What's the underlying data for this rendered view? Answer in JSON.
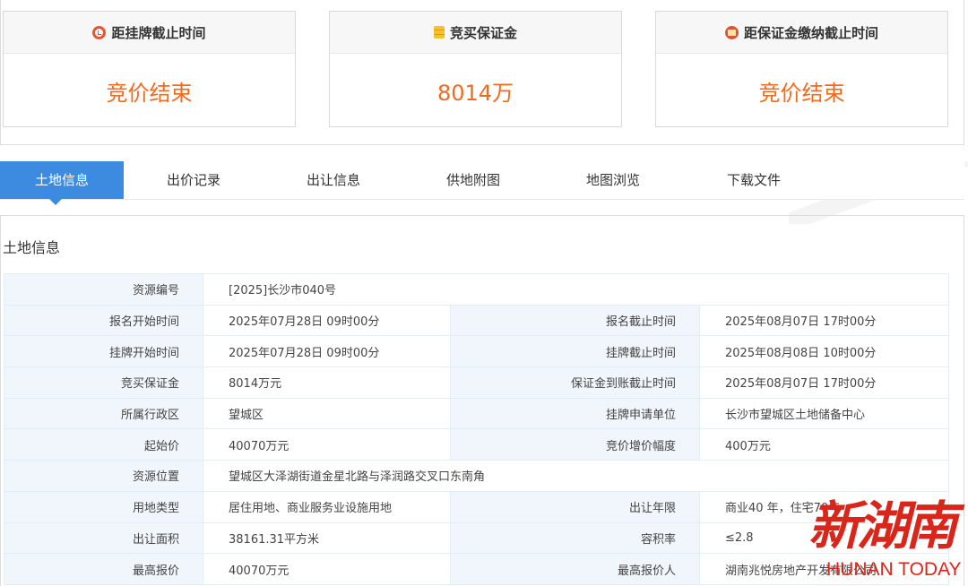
{
  "cards": [
    {
      "title": "距挂牌截止时间",
      "value": "竞价结束",
      "icon": "clock-icon"
    },
    {
      "title": "竞买保证金",
      "value": "8014万",
      "icon": "coins-icon"
    },
    {
      "title": "距保证金缴纳截止时间",
      "value": "竞价结束",
      "icon": "alarm-icon"
    }
  ],
  "tabs": [
    "土地信息",
    "出价记录",
    "出让信息",
    "供地附图",
    "地图浏览",
    "下载文件"
  ],
  "section": {
    "title": "土地信息"
  },
  "rows": [
    {
      "l1": "资源编号",
      "v1": "[2025]长沙市040号"
    },
    {
      "l1": "报名开始时间",
      "v1": "2025年07月28日 09时00分",
      "l2": "报名截止时间",
      "v2": "2025年08月07日 17时00分"
    },
    {
      "l1": "挂牌开始时间",
      "v1": "2025年07月28日 09时00分",
      "l2": "挂牌截止时间",
      "v2": "2025年08月08日 10时00分"
    },
    {
      "l1": "竞买保证金",
      "v1": "8014万元",
      "l2": "保证金到账截止时间",
      "v2": "2025年08月07日 17时00分"
    },
    {
      "l1": "所属行政区",
      "v1": "望城区",
      "l2": "挂牌申请单位",
      "v2": "长沙市望城区土地储备中心"
    },
    {
      "l1": "起始价",
      "v1": "40070万元",
      "l2": "竞价增价幅度",
      "v2": "400万元"
    },
    {
      "l1": "资源位置",
      "v1": "望城区大泽湖街道金星北路与泽润路交叉口东南角"
    },
    {
      "l1": "用地类型",
      "v1": "居住用地、商业服务业设施用地",
      "l2": "出让年限",
      "v2": "商业40 年，住宅70年"
    },
    {
      "l1": "出让面积",
      "v1": "38161.31平方米",
      "l2": "容积率",
      "v2": "≤2.8"
    },
    {
      "l1": "最高报价",
      "v1": "40070万元",
      "l2": "最高报价人",
      "v2": "湖南兆悦房地产开发有限公司"
    }
  ],
  "watermark": {
    "cn": "新湖南",
    "en": "HUNAN TODAY"
  },
  "colors": {
    "accent": "#3d8be0",
    "value_orange": "#f26b1d",
    "label_bg": "#f0f6fb",
    "watermark_red": "#d8261b"
  }
}
